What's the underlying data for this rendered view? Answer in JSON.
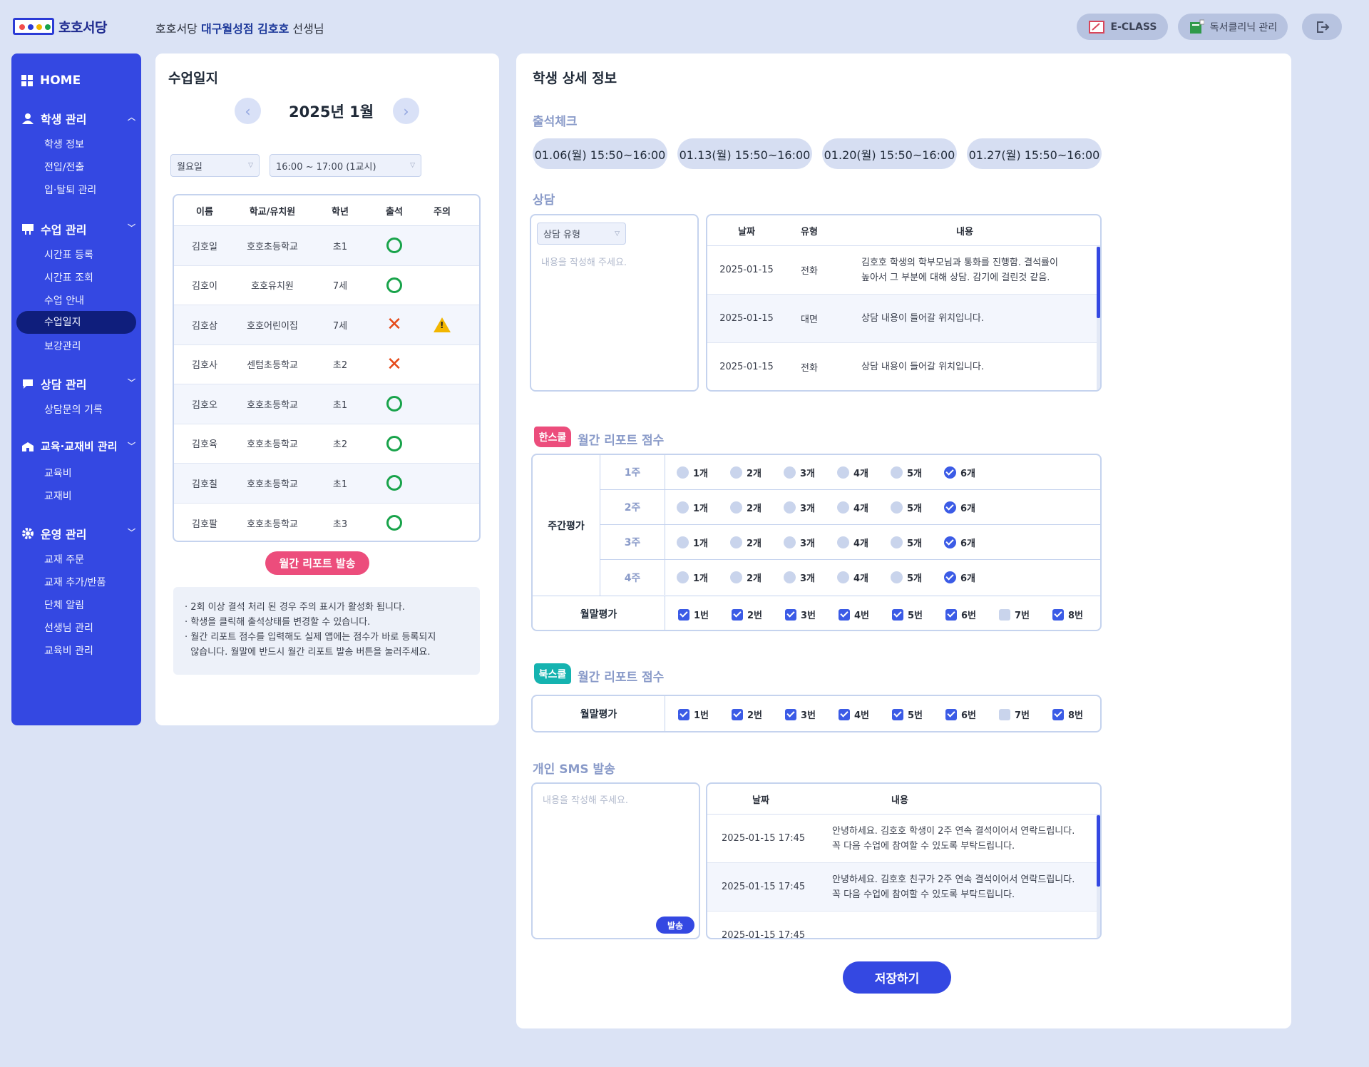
{
  "header": {
    "brand": "호호서당",
    "greeting_prefix": "호호서당",
    "greeting_branch_teacher": "대구월성점 김호호",
    "greeting_suffix": "선생님",
    "eclass_label": "E-CLASS",
    "clinic_label": "독서클리닉 관리"
  },
  "sidebar": {
    "home": "HOME",
    "sections": [
      {
        "label": "학생 관리",
        "items": [
          "학생 정보",
          "전입/전출",
          "입·탈퇴 관리"
        ]
      },
      {
        "label": "수업 관리",
        "items": [
          "시간표 등록",
          "시간표 조회",
          "수업 안내",
          "수업일지",
          "보강관리"
        ]
      },
      {
        "label": "상담 관리",
        "items": [
          "상담문의 기록"
        ]
      },
      {
        "label": "교육·교재비 관리",
        "items": [
          "교육비",
          "교재비"
        ]
      },
      {
        "label": "운영 관리",
        "items": [
          "교재 주문",
          "교재 추가/반품",
          "단체 알림",
          "선생님 관리",
          "교육비 관리"
        ]
      }
    ],
    "active_item": "수업일지"
  },
  "journal": {
    "title": "수업일지",
    "month": "2025년 1월",
    "day_select": "월요일",
    "time_select": "16:00 ~ 17:00 (1교시)",
    "columns": [
      "이름",
      "학교/유치원",
      "학년",
      "출석",
      "주의"
    ],
    "rows": [
      {
        "name": "김호일",
        "school": "호호초등학교",
        "grade": "초1",
        "att": "O",
        "warn": false
      },
      {
        "name": "김호이",
        "school": "호호유치원",
        "grade": "7세",
        "att": "O",
        "warn": false
      },
      {
        "name": "김호삼",
        "school": "호호어린이집",
        "grade": "7세",
        "att": "X",
        "warn": true
      },
      {
        "name": "김호사",
        "school": "센텀초등학교",
        "grade": "초2",
        "att": "X",
        "warn": false
      },
      {
        "name": "김호오",
        "school": "호호초등학교",
        "grade": "초1",
        "att": "O",
        "warn": false
      },
      {
        "name": "김호육",
        "school": "호호초등학교",
        "grade": "초2",
        "att": "O",
        "warn": false
      },
      {
        "name": "김호칠",
        "school": "호호초등학교",
        "grade": "초1",
        "att": "O",
        "warn": false
      },
      {
        "name": "김호팔",
        "school": "호호초등학교",
        "grade": "초3",
        "att": "O",
        "warn": false
      }
    ],
    "report_button": "월간 리포트 발송",
    "notes": [
      "· 2회 이상 결석 처리 된 경우 주의 표시가 활성화 됩니다.",
      "· 학생을 클릭해 출석상태를 변경할 수 있습니다.",
      "· 월간 리포트 점수를 입력해도 실제 앱에는 점수가 바로 등록되지",
      "  않습니다. 월말에 반드시 월간 리포트 발송 버튼을 눌러주세요."
    ]
  },
  "detail": {
    "title": "학생 상세 정보",
    "attendance_title": "출석체크",
    "attendance_dates": [
      "01.06(월) 15:50~16:00",
      "01.13(월) 15:50~16:00",
      "01.20(월) 15:50~16:00",
      "01.27(월) 15:50~16:00"
    ],
    "counsel_title": "상담",
    "counsel_type_placeholder": "상담 유형",
    "counsel_input_placeholder": "내용을 작성해 주세요.",
    "counsel_columns": [
      "날짜",
      "유형",
      "내용"
    ],
    "counsel_rows": [
      {
        "date": "2025-01-15",
        "type": "전화",
        "content1": "김호호 학생의 학부모님과 통화를 진행함. 결석률이",
        "content2": "높아서 그 부분에 대해 상담. 감기에 걸린것 같음."
      },
      {
        "date": "2025-01-15",
        "type": "대면",
        "content1": "상담 내용이 들어갈 위치입니다.",
        "content2": ""
      },
      {
        "date": "2025-01-15",
        "type": "전화",
        "content1": "상담 내용이 들어갈 위치입니다.",
        "content2": ""
      }
    ],
    "hanschool_tag": "한스쿨",
    "report_title": "월간 리포트 점수",
    "weekly_label": "주간평가",
    "weeks": [
      "1주",
      "2주",
      "3주",
      "4주"
    ],
    "counts": [
      "1개",
      "2개",
      "3개",
      "4개",
      "5개",
      "6개"
    ],
    "weekly_selected": [
      6,
      6,
      6,
      6
    ],
    "monthly_label": "월말평가",
    "monthly_options": [
      "1번",
      "2번",
      "3번",
      "4번",
      "5번",
      "6번",
      "7번",
      "8번"
    ],
    "monthly_checked": [
      true,
      true,
      true,
      true,
      true,
      true,
      false,
      true
    ],
    "bookschool_tag": "북스쿨",
    "book_monthly_checked": [
      true,
      true,
      true,
      true,
      true,
      true,
      false,
      true
    ],
    "sms_title": "개인 SMS 발송",
    "sms_placeholder": "내용을 작성해 주세요.",
    "sms_send": "발송",
    "sms_columns": [
      "날짜",
      "내용"
    ],
    "sms_rows": [
      {
        "date": "2025-01-15 17:45",
        "content1": "안녕하세요.  김호호 학생이 2주 연속 결석이어서 연락드립니다.",
        "content2": "꼭 다음 수업에 참여할 수 있도록 부탁드립니다."
      },
      {
        "date": "2025-01-15 17:45",
        "content1": "안녕하세요.  김호호 친구가 2주 연속 결석이어서 연락드립니다.",
        "content2": "꼭 다음 수업에 참여할 수 있도록 부탁드립니다."
      },
      {
        "date": "2025-01-15 17:45",
        "content1": "",
        "content2": ""
      }
    ],
    "save_button": "저장하기"
  },
  "colors": {
    "primary": "#3448e2",
    "pink": "#ec4d7c",
    "teal": "#15b3b0",
    "background": "#dbe3f5"
  }
}
